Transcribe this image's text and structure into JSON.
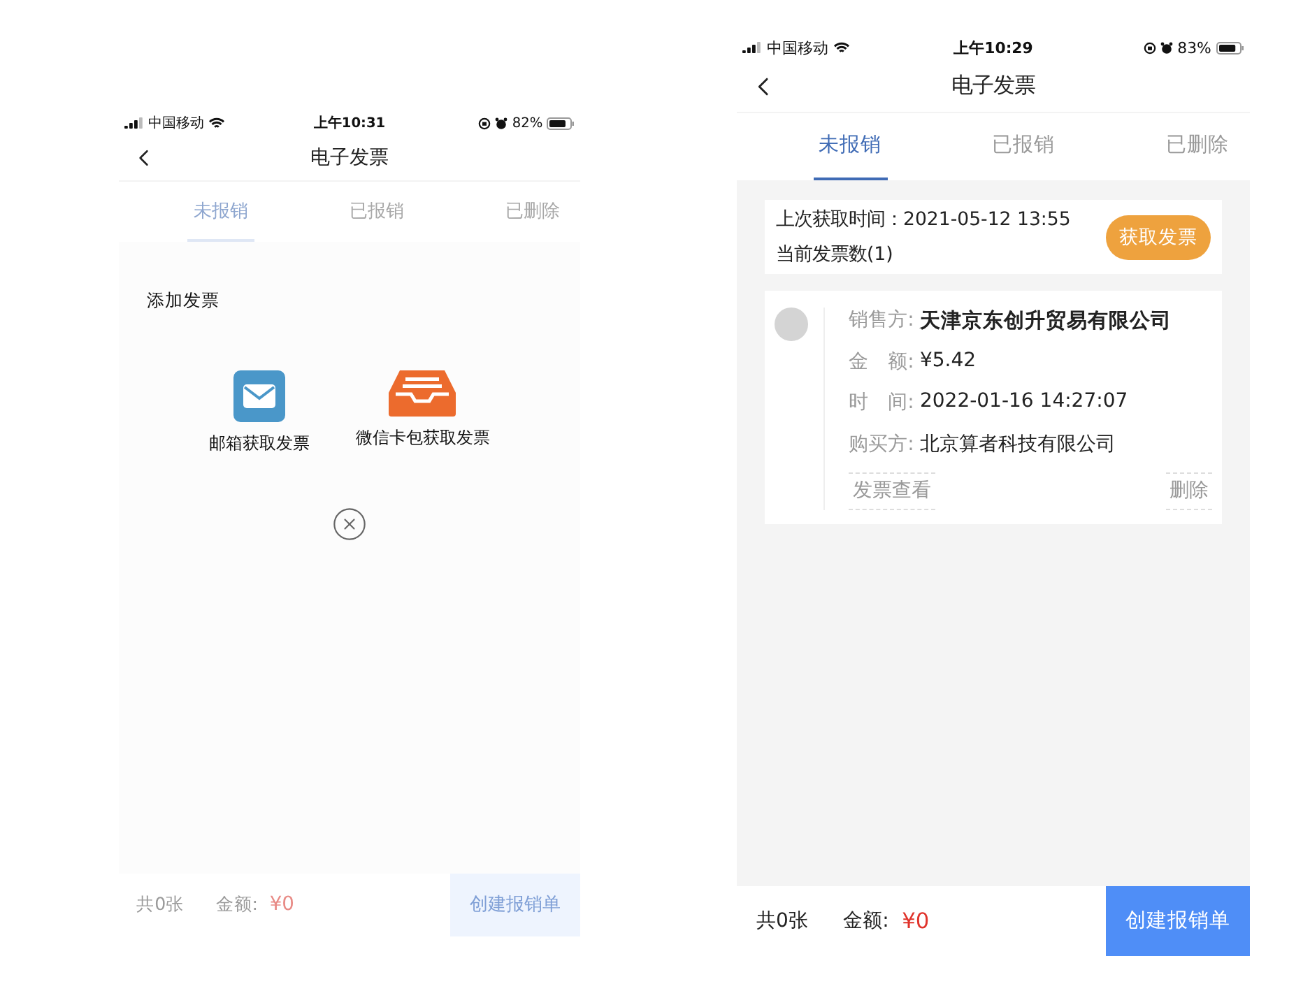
{
  "screens": [
    {
      "status_bar": {
        "carrier": "中国移动",
        "time": "上午10:31",
        "battery": "82%"
      },
      "nav": {
        "title": "电子发票"
      },
      "tabs": [
        {
          "label": "未报销",
          "selected": true
        },
        {
          "label": "已报销",
          "selected": false
        },
        {
          "label": "已删除",
          "selected": false
        }
      ],
      "dialog": {
        "title": "添加发票",
        "options": [
          {
            "kind": "mail",
            "label": "邮箱获取发票"
          },
          {
            "kind": "tray",
            "label": "微信卡包获取发票"
          }
        ]
      },
      "footer": {
        "count": "共0张",
        "amount_label": "金额:",
        "amount": "¥0",
        "button": "创建报销单"
      }
    },
    {
      "status_bar": {
        "carrier": "中国移动",
        "time": "上午10:29",
        "battery": "83%"
      },
      "nav": {
        "title": "电子发票"
      },
      "tabs": [
        {
          "label": "未报销",
          "selected": true
        },
        {
          "label": "已报销",
          "selected": false
        },
        {
          "label": "已删除",
          "selected": false
        }
      ],
      "fetch_bar": {
        "last_time": "上次获取时间：2021-05-12 13:55",
        "count": "当前发票数(1)",
        "button": "获取发票"
      },
      "invoices": [
        {
          "fields": [
            {
              "label": "销售方:",
              "value": "天津京东创升贸易有限公司",
              "kind": "bold"
            },
            {
              "label": "金　额:",
              "value": "¥5.42",
              "kind": "plain"
            },
            {
              "label": "时　间:",
              "value": "2022-01-16 14:27:07",
              "kind": "plain"
            },
            {
              "label": "购买方:",
              "value": "北京算者科技有限公司",
              "kind": "plain"
            }
          ],
          "view": "发票查看",
          "delete": "删除"
        }
      ],
      "footer": {
        "count": "共0张",
        "amount_label": "金额:",
        "amount": "¥0",
        "button": "创建报销单"
      }
    }
  ]
}
